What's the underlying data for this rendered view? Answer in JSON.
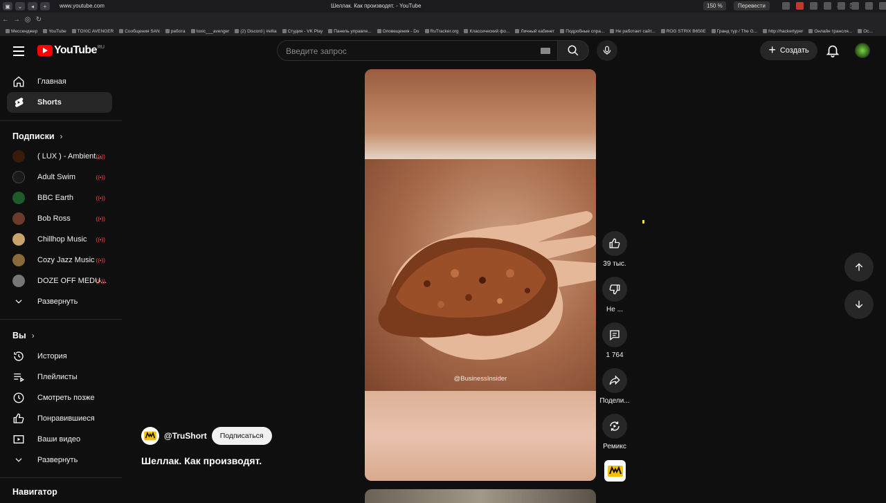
{
  "browser": {
    "url": "www.youtube.com",
    "title": "Шеллак. Как производят. - YouTube",
    "zoom": "150 %",
    "translate": "Перевести",
    "bookmarks": [
      "Мессенджер",
      "YouTube",
      "TOXIC AVENGER",
      "Сообщения SAN",
      "работа",
      "toxic___avenger",
      "(2) Discord | #ellia",
      "Студия - VK Play",
      "Панель управле...",
      "Оповещения - Do",
      "RuTracker.org",
      "Классический фо...",
      "Личный кабинет",
      "Подробные спра...",
      "Не работает сайт...",
      "ROG STRIX B650E",
      "Гранд тур / The G...",
      "http://hackertyper",
      "Онлайн трансля...",
      "Ос..."
    ]
  },
  "header": {
    "logo_text": "YouTube",
    "logo_country": "RU",
    "search_placeholder": "Введите запрос",
    "create_label": "Создать"
  },
  "sidebar": {
    "main": [
      {
        "label": "Главная",
        "icon": "home-icon"
      },
      {
        "label": "Shorts",
        "icon": "shorts-icon"
      }
    ],
    "subs_heading": "Подписки",
    "subscriptions": [
      {
        "label": "( LUX ) - Ambient...",
        "color": "#3a1a0a"
      },
      {
        "label": "Adult Swim",
        "color": "#1a1a1a"
      },
      {
        "label": "BBC Earth",
        "color": "#1f5a2a"
      },
      {
        "label": "Bob Ross",
        "color": "#6a3a2a"
      },
      {
        "label": "Chillhop Music",
        "color": "#c9a46a"
      },
      {
        "label": "Cozy Jazz Music",
        "color": "#8a6a3a"
      },
      {
        "label": "DOZE OFF MEDU...",
        "color": "#777777"
      }
    ],
    "expand_subs": "Развернуть",
    "you_heading": "Вы",
    "you_items": [
      {
        "label": "История",
        "icon": "history-icon"
      },
      {
        "label": "Плейлисты",
        "icon": "playlists-icon"
      },
      {
        "label": "Смотреть позже",
        "icon": "watch-later-icon"
      },
      {
        "label": "Понравившиеся",
        "icon": "liked-icon"
      },
      {
        "label": "Ваши видео",
        "icon": "your-videos-icon"
      }
    ],
    "expand_you": "Развернуть",
    "nav_heading": "Навигатор"
  },
  "short": {
    "watermark": "@BusinessInsider",
    "channel": "@TruShort",
    "subscribe_label": "Подписаться",
    "title": "Шеллак. Как производят.",
    "actions": {
      "likes": "39 тыс.",
      "dislike": "Не ...",
      "comments": "1 764",
      "share": "Подели...",
      "remix": "Ремикс"
    }
  },
  "colors": {
    "bg": "#0f0f0f",
    "accent": "#ff0000",
    "live": "#ff4e45"
  }
}
